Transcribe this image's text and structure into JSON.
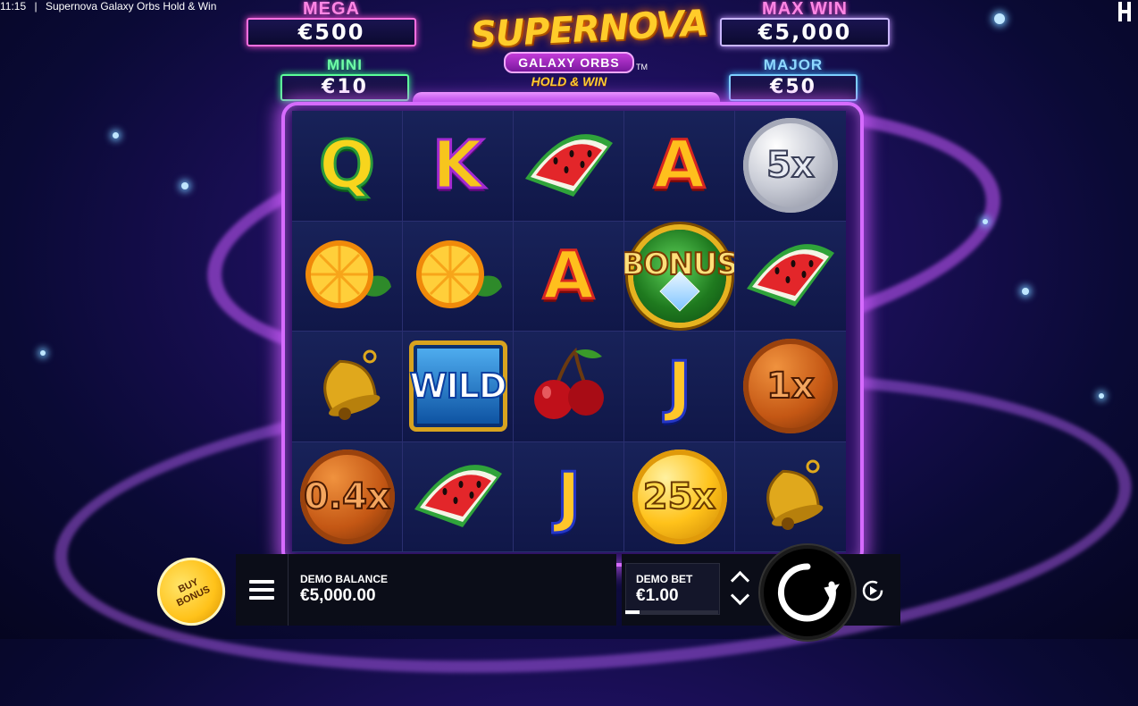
{
  "status_bar": {
    "time": "11:15",
    "separator": "|",
    "title": "Supernova Galaxy Orbs Hold & Win"
  },
  "logo": {
    "title": "SUPERNOVA",
    "subtitle": "GALAXY ORBS",
    "tagline": "HOLD & WIN",
    "tm": "TM"
  },
  "jackpots": {
    "mega": {
      "label": "MEGA",
      "value": "€500"
    },
    "max_win": {
      "label": "MAX WIN",
      "value": "€5,000"
    },
    "mini": {
      "label": "MINI",
      "value": "€10"
    },
    "major": {
      "label": "MAJOR",
      "value": "€50"
    }
  },
  "reels": {
    "rows": [
      [
        {
          "type": "letter",
          "symbol": "Q"
        },
        {
          "type": "letter",
          "symbol": "K"
        },
        {
          "type": "watermelon"
        },
        {
          "type": "letter",
          "symbol": "A"
        },
        {
          "type": "coin",
          "style": "silver",
          "value": "5x"
        }
      ],
      [
        {
          "type": "orange"
        },
        {
          "type": "orange"
        },
        {
          "type": "letter",
          "symbol": "A"
        },
        {
          "type": "bonus",
          "value": "BONUS"
        },
        {
          "type": "watermelon"
        }
      ],
      [
        {
          "type": "bell"
        },
        {
          "type": "wild",
          "value": "WILD"
        },
        {
          "type": "cherry"
        },
        {
          "type": "letter",
          "symbol": "J"
        },
        {
          "type": "coin",
          "style": "bronze",
          "value": "1x"
        }
      ],
      [
        {
          "type": "coin",
          "style": "bronze",
          "value": "0.4x"
        },
        {
          "type": "watermelon"
        },
        {
          "type": "letter",
          "symbol": "J"
        },
        {
          "type": "coin",
          "style": "gold",
          "value": "25x"
        },
        {
          "type": "bell"
        }
      ]
    ]
  },
  "controls": {
    "buy_bonus": "BUY BONUS",
    "menu_icon": "hamburger-menu-icon",
    "balance_label": "DEMO BALANCE",
    "balance_value": "€5,000.00",
    "bet_label": "DEMO BET",
    "bet_value": "€1.00",
    "bet_level_fraction": 0.15,
    "spin_icon": "spin-arrow-icon",
    "autoplay_icon": "autoplay-icon"
  }
}
